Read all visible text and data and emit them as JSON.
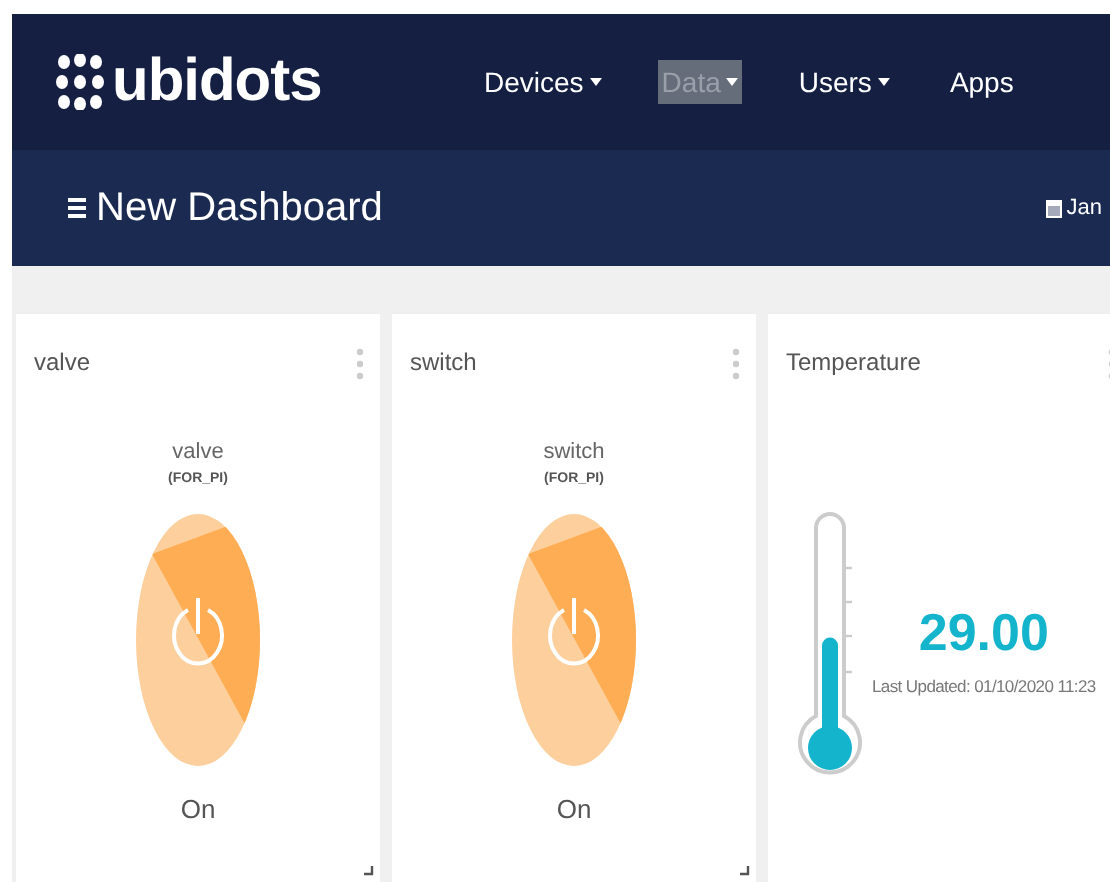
{
  "brand": {
    "name": "ubidots"
  },
  "nav": [
    {
      "label": "Devices",
      "dropdown": true,
      "selected": false
    },
    {
      "label": "Data",
      "dropdown": true,
      "selected": true
    },
    {
      "label": "Users",
      "dropdown": true,
      "selected": false
    },
    {
      "label": "Apps",
      "dropdown": false,
      "selected": false
    }
  ],
  "dashboard": {
    "title": "New Dashboard",
    "date": "Jan"
  },
  "widgets": [
    {
      "kind": "switch",
      "title": "valve",
      "name": "valve",
      "device": "(FOR_PI)",
      "on": true,
      "state_label": "On"
    },
    {
      "kind": "switch",
      "title": "switch",
      "name": "switch",
      "device": "(FOR_PI)",
      "on": true,
      "state_label": "On"
    },
    {
      "kind": "thermometer",
      "title": "Temperature",
      "value": "29.00",
      "level": 0.45,
      "updated": "Last Updated: 01/10/2020 11:23"
    }
  ]
}
